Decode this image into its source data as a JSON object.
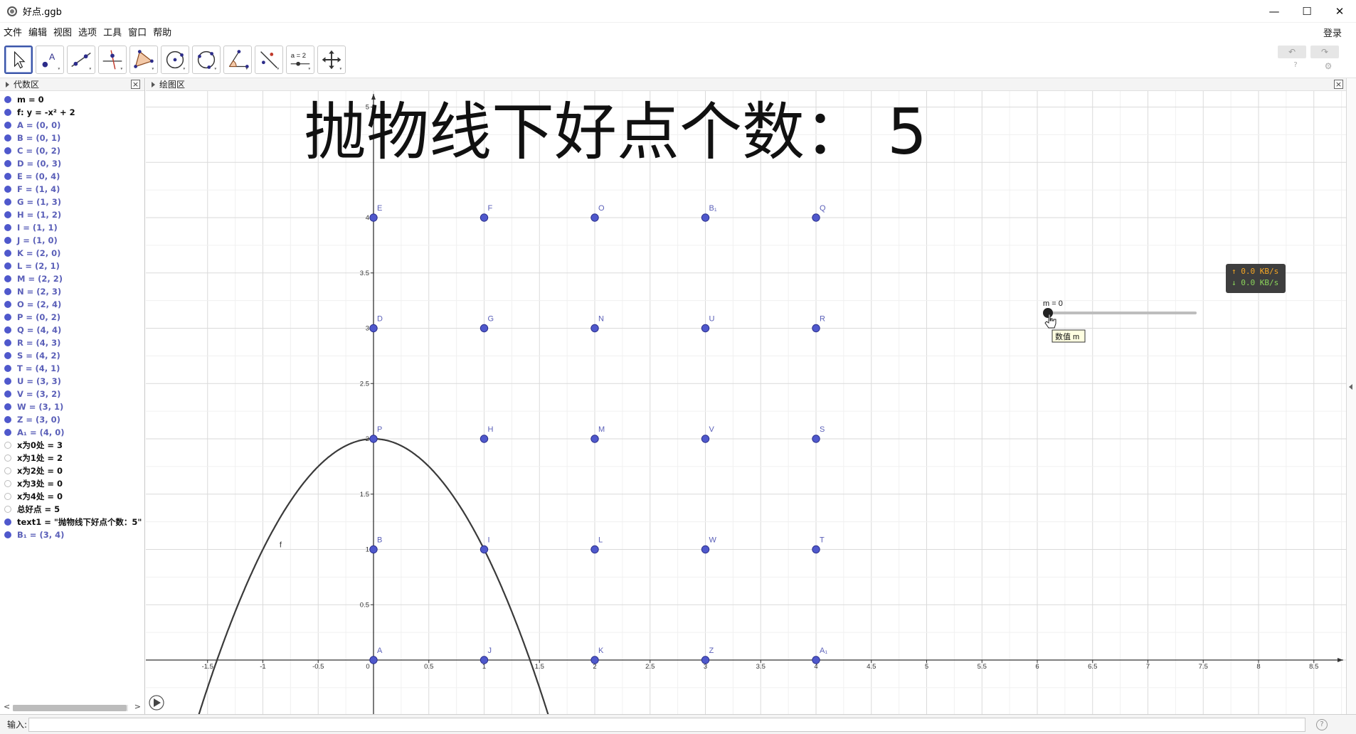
{
  "window": {
    "title": "好点.ggb",
    "minimize": "—",
    "maximize": "☐",
    "close": "✕"
  },
  "menu": [
    "文件",
    "编辑",
    "视图",
    "选项",
    "工具",
    "窗口",
    "帮助"
  ],
  "login_label": "登录",
  "toolbar_tools": [
    "move-tool",
    "point-tool",
    "line-tool",
    "perpendicular-tool",
    "polygon-tool",
    "circle-tool",
    "conic-tool",
    "angle-tool",
    "reflect-tool",
    "slider-tool",
    "move-graphics-tool"
  ],
  "slider_tool_label": "a = 2",
  "algebra": {
    "title": "代数区",
    "rows": [
      {
        "text": "m = 0",
        "dot": "on",
        "kind": "num"
      },
      {
        "text": "f: y = -x² + 2",
        "dot": "on",
        "kind": "fn"
      },
      {
        "text": "A = (0, 0)",
        "dot": "on",
        "kind": "pt"
      },
      {
        "text": "B = (0, 1)",
        "dot": "on",
        "kind": "pt"
      },
      {
        "text": "C = (0, 2)",
        "dot": "on",
        "kind": "pt"
      },
      {
        "text": "D = (0, 3)",
        "dot": "on",
        "kind": "pt"
      },
      {
        "text": "E = (0, 4)",
        "dot": "on",
        "kind": "pt"
      },
      {
        "text": "F = (1, 4)",
        "dot": "on",
        "kind": "pt"
      },
      {
        "text": "G = (1, 3)",
        "dot": "on",
        "kind": "pt"
      },
      {
        "text": "H = (1, 2)",
        "dot": "on",
        "kind": "pt"
      },
      {
        "text": "I = (1, 1)",
        "dot": "on",
        "kind": "pt"
      },
      {
        "text": "J = (1, 0)",
        "dot": "on",
        "kind": "pt"
      },
      {
        "text": "K = (2, 0)",
        "dot": "on",
        "kind": "pt"
      },
      {
        "text": "L = (2, 1)",
        "dot": "on",
        "kind": "pt"
      },
      {
        "text": "M = (2, 2)",
        "dot": "on",
        "kind": "pt"
      },
      {
        "text": "N = (2, 3)",
        "dot": "on",
        "kind": "pt"
      },
      {
        "text": "O = (2, 4)",
        "dot": "on",
        "kind": "pt"
      },
      {
        "text": "P = (0, 2)",
        "dot": "on",
        "kind": "pt"
      },
      {
        "text": "Q = (4, 4)",
        "dot": "on",
        "kind": "pt"
      },
      {
        "text": "R = (4, 3)",
        "dot": "on",
        "kind": "pt"
      },
      {
        "text": "S = (4, 2)",
        "dot": "on",
        "kind": "pt"
      },
      {
        "text": "T = (4, 1)",
        "dot": "on",
        "kind": "pt"
      },
      {
        "text": "U = (3, 3)",
        "dot": "on",
        "kind": "pt"
      },
      {
        "text": "V = (3, 2)",
        "dot": "on",
        "kind": "pt"
      },
      {
        "text": "W = (3, 1)",
        "dot": "on",
        "kind": "pt"
      },
      {
        "text": "Z = (3, 0)",
        "dot": "on",
        "kind": "pt"
      },
      {
        "text": "A₁ = (4, 0)",
        "dot": "on",
        "kind": "pt"
      },
      {
        "text": "x为0处 = 3",
        "dot": "off",
        "kind": "num"
      },
      {
        "text": "x为1处 = 2",
        "dot": "off",
        "kind": "num"
      },
      {
        "text": "x为2处 = 0",
        "dot": "off",
        "kind": "num"
      },
      {
        "text": "x为3处 = 0",
        "dot": "off",
        "kind": "num"
      },
      {
        "text": "x为4处 = 0",
        "dot": "off",
        "kind": "num"
      },
      {
        "text": "总好点 = 5",
        "dot": "off",
        "kind": "num"
      },
      {
        "text": "text1 = \"抛物线下好点个数：5\"",
        "dot": "on",
        "kind": "num"
      },
      {
        "text": "B₁ = (3, 4)",
        "dot": "on",
        "kind": "pt"
      }
    ]
  },
  "graphics": {
    "title": "绘图区",
    "big_text": "抛物线下好点个数：  5",
    "x_ticks": [
      "-1.5",
      "-1",
      "-0.5",
      "0",
      "0.5",
      "1",
      "1.5",
      "2",
      "2.5",
      "3",
      "3.5",
      "4",
      "4.5",
      "5",
      "5.5",
      "6",
      "6.5",
      "7",
      "7.5",
      "8",
      "8.5"
    ],
    "y_ticks": [
      "0.5",
      "1",
      "1.5",
      "2",
      "2.5",
      "3",
      "3.5",
      "4",
      "5"
    ],
    "points": [
      {
        "label": "A",
        "x": 0,
        "y": 0
      },
      {
        "label": "B",
        "x": 0,
        "y": 1
      },
      {
        "label": "P",
        "x": 0,
        "y": 2
      },
      {
        "label": "D",
        "x": 0,
        "y": 3
      },
      {
        "label": "E",
        "x": 0,
        "y": 4
      },
      {
        "label": "J",
        "x": 1,
        "y": 0
      },
      {
        "label": "I",
        "x": 1,
        "y": 1
      },
      {
        "label": "H",
        "x": 1,
        "y": 2
      },
      {
        "label": "G",
        "x": 1,
        "y": 3
      },
      {
        "label": "F",
        "x": 1,
        "y": 4
      },
      {
        "label": "K",
        "x": 2,
        "y": 0
      },
      {
        "label": "L",
        "x": 2,
        "y": 1
      },
      {
        "label": "M",
        "x": 2,
        "y": 2
      },
      {
        "label": "N",
        "x": 2,
        "y": 3
      },
      {
        "label": "O",
        "x": 2,
        "y": 4
      },
      {
        "label": "Z",
        "x": 3,
        "y": 0
      },
      {
        "label": "W",
        "x": 3,
        "y": 1
      },
      {
        "label": "V",
        "x": 3,
        "y": 2
      },
      {
        "label": "U",
        "x": 3,
        "y": 3
      },
      {
        "label": "B₁",
        "x": 3,
        "y": 4
      },
      {
        "label": "A₁",
        "x": 4,
        "y": 0
      },
      {
        "label": "T",
        "x": 4,
        "y": 1
      },
      {
        "label": "S",
        "x": 4,
        "y": 2
      },
      {
        "label": "R",
        "x": 4,
        "y": 3
      },
      {
        "label": "Q",
        "x": 4,
        "y": 4
      }
    ],
    "function_label": "f",
    "slider_label": "m = 0",
    "slider_value": 0,
    "slider_tooltip": "数值 m",
    "colors": {
      "point": "#4f58cc",
      "curve": "#3a3a3a",
      "grid": "#e4e4e4",
      "axis": "#333333"
    }
  },
  "net_speed": {
    "up": "↑ 0.0 KB/s",
    "down": "↓ 0.0 KB/s"
  },
  "input": {
    "label": "输入:",
    "value": ""
  }
}
